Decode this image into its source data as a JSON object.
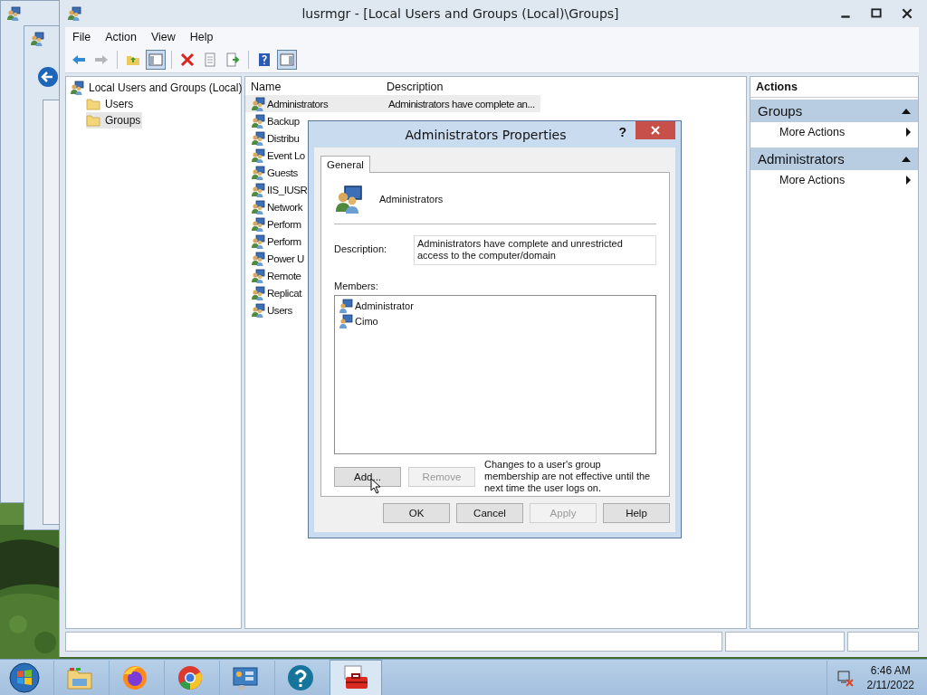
{
  "window": {
    "title": "lusrmgr - [Local Users and Groups (Local)\\Groups]"
  },
  "menu": [
    "File",
    "Action",
    "View",
    "Help"
  ],
  "toolbar": [
    {
      "kind": "back",
      "pressed": false,
      "disabled": false
    },
    {
      "kind": "forward",
      "pressed": false,
      "disabled": true
    },
    {
      "kind": "separator"
    },
    {
      "kind": "up",
      "pressed": false,
      "disabled": false
    },
    {
      "kind": "tree",
      "pressed": true,
      "disabled": false
    },
    {
      "kind": "separator"
    },
    {
      "kind": "delete",
      "pressed": false,
      "disabled": false
    },
    {
      "kind": "properties",
      "pressed": false,
      "disabled": false
    },
    {
      "kind": "export",
      "pressed": false,
      "disabled": false
    },
    {
      "kind": "separator"
    },
    {
      "kind": "help",
      "pressed": false,
      "disabled": false
    },
    {
      "kind": "pane",
      "pressed": true,
      "disabled": false
    }
  ],
  "tree": {
    "label": "Local Users and Groups (Local)",
    "children": [
      {
        "label": "Users",
        "selected": false
      },
      {
        "label": "Groups",
        "selected": true
      }
    ]
  },
  "list": {
    "columns": [
      "Name",
      "Description"
    ],
    "rows": [
      {
        "name": "Administrators",
        "description": "Administrators have complete an...",
        "selected": true
      },
      {
        "name": "Backup",
        "selected": false
      },
      {
        "name": "Distribu",
        "selected": false
      },
      {
        "name": "Event Lo",
        "selected": false
      },
      {
        "name": "Guests",
        "selected": false
      },
      {
        "name": "IIS_IUSR",
        "selected": false
      },
      {
        "name": "Network",
        "selected": false
      },
      {
        "name": "Perform",
        "selected": false
      },
      {
        "name": "Perform",
        "selected": false
      },
      {
        "name": "Power U",
        "selected": false
      },
      {
        "name": "Remote",
        "selected": false
      },
      {
        "name": "Replicat",
        "selected": false
      },
      {
        "name": "Users",
        "selected": false
      }
    ]
  },
  "actions": {
    "title": "Actions",
    "sections": [
      {
        "title": "Groups",
        "expanded": true,
        "items": [
          "More Actions"
        ]
      },
      {
        "title": "Administrators",
        "expanded": true,
        "items": [
          "More Actions"
        ]
      }
    ]
  },
  "dialog": {
    "title": "Administrators Properties",
    "help": "?",
    "tabs": [
      {
        "label": "General",
        "selected": true
      }
    ],
    "group_name": "Administrators",
    "description_label": "Description:",
    "description": "Administrators have complete and unrestricted access to the computer/domain",
    "members_label": "Members:",
    "members": [
      "Administrator",
      "Cimo"
    ],
    "member_buttons": [
      {
        "label": "Add...",
        "disabled": false
      },
      {
        "label": "Remove",
        "disabled": true
      }
    ],
    "note": "Changes to a user's group membership are not effective until the next time the user logs on.",
    "buttons": [
      {
        "label": "OK",
        "disabled": false
      },
      {
        "label": "Cancel",
        "disabled": false
      },
      {
        "label": "Apply",
        "disabled": true
      },
      {
        "label": "Help",
        "disabled": false
      }
    ]
  },
  "taskbar": {
    "items": [
      {
        "kind": "explorer",
        "selected": false
      },
      {
        "kind": "firefox",
        "selected": false
      },
      {
        "kind": "chrome",
        "selected": false
      },
      {
        "kind": "control",
        "selected": false
      },
      {
        "kind": "help",
        "selected": false
      },
      {
        "kind": "toolbox",
        "selected": true
      }
    ],
    "time": "6:46 AM",
    "date": "2/11/2022"
  }
}
